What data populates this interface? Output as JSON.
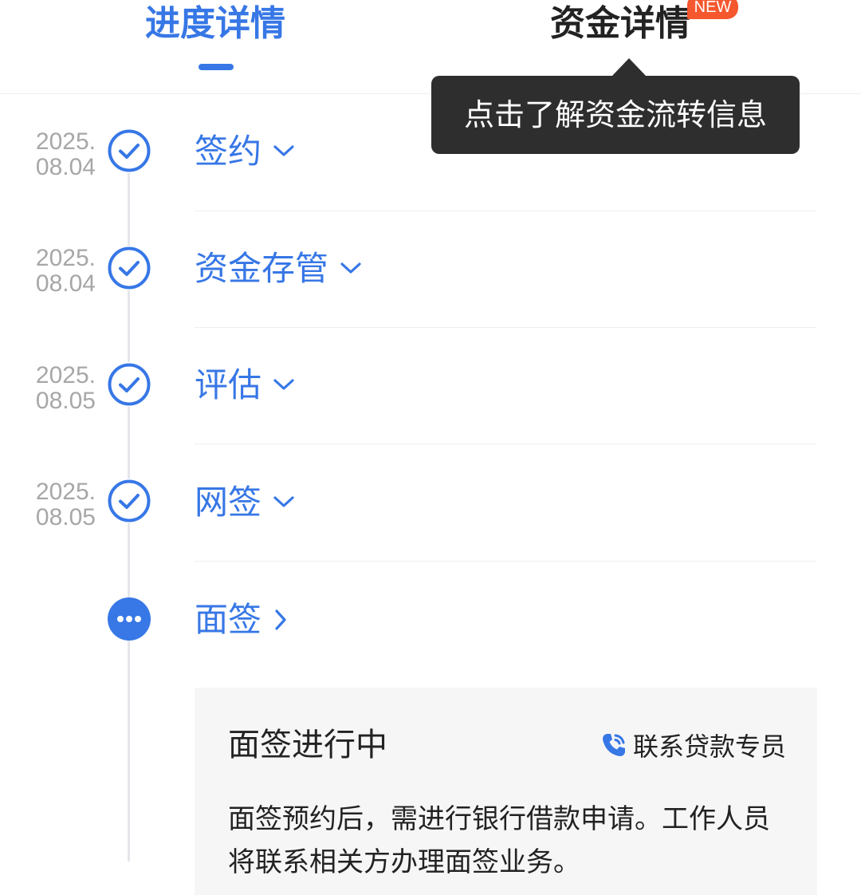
{
  "tabs": {
    "progress_label": "进度详情",
    "funds_label": "资金详情",
    "new_badge": "NEW"
  },
  "tooltip": {
    "text": "点击了解资金流转信息"
  },
  "steps": [
    {
      "date_line1": "2025.",
      "date_line2": "08.04",
      "label": "签约",
      "status": "done",
      "chevron": "chevron-down"
    },
    {
      "date_line1": "2025.",
      "date_line2": "08.04",
      "label": "资金存管",
      "status": "done",
      "chevron": "chevron-down"
    },
    {
      "date_line1": "2025.",
      "date_line2": "08.05",
      "label": "评估",
      "status": "done",
      "chevron": "chevron-down"
    },
    {
      "date_line1": "2025.",
      "date_line2": "08.05",
      "label": "网签",
      "status": "done",
      "chevron": "chevron-down"
    },
    {
      "label": "面签",
      "status": "in-progress",
      "chevron": "chevron-right"
    }
  ],
  "detail": {
    "title": "面签进行中",
    "contact_label": "联系贷款专员",
    "description": "面签预约后，需进行银行借款申请。工作人员将联系相关方办理面签业务。"
  },
  "colors": {
    "accent": "#3777e6",
    "badge": "#f5572e",
    "tooltip_bg": "#2e2e2e",
    "date_text": "#a7a7a7"
  }
}
